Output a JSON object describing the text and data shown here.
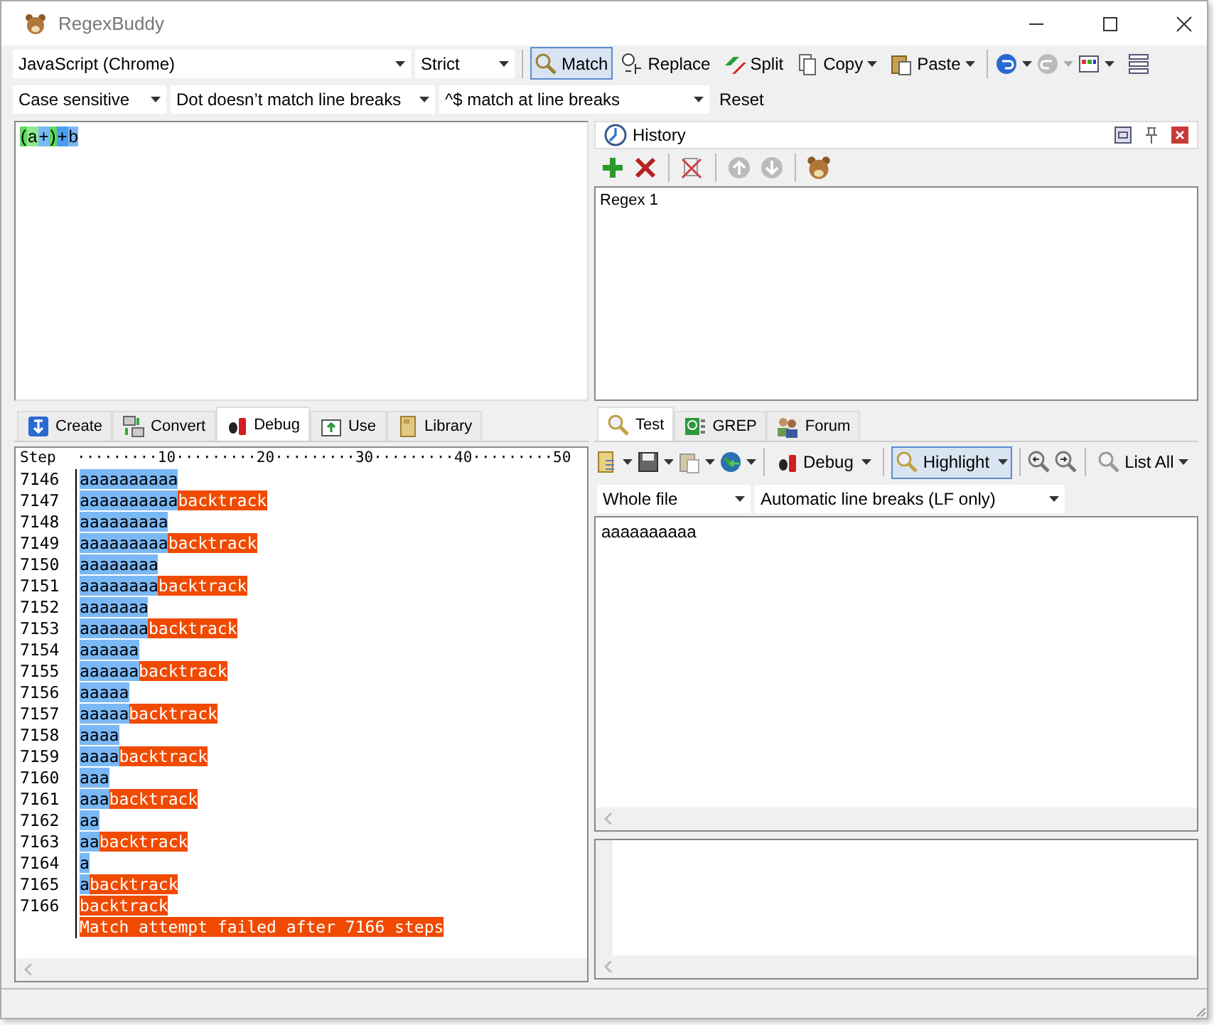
{
  "window": {
    "title": "RegexBuddy"
  },
  "toolbar": {
    "flavor": "JavaScript (Chrome)",
    "mode": "Strict",
    "buttons": [
      {
        "label": "Match",
        "selected": true,
        "menu": false,
        "kind": "match"
      },
      {
        "label": "Replace",
        "selected": false,
        "menu": false,
        "kind": "replace"
      },
      {
        "label": "Split",
        "selected": false,
        "menu": false,
        "kind": "split"
      },
      {
        "label": "Copy",
        "selected": false,
        "menu": true,
        "kind": "copy"
      },
      {
        "label": "Paste",
        "selected": false,
        "menu": true,
        "kind": "paste"
      }
    ]
  },
  "options": {
    "case": "Case sensitive",
    "dot": "Dot doesn’t match line breaks",
    "anchors": "^$ match at line breaks",
    "reset": "Reset"
  },
  "regex": [
    {
      "text": "(",
      "color": "#5ed85e"
    },
    {
      "text": "a",
      "color": "#8ee88e"
    },
    {
      "text": "+",
      "color": "#7ab8f5"
    },
    {
      "text": ")",
      "color": "#5ed85e"
    },
    {
      "text": "+",
      "color": "#4a9cf0"
    },
    {
      "text": "b",
      "color": "#7ab8f5"
    }
  ],
  "history": {
    "title": "History",
    "items": [
      {
        "label": "Regex 1",
        "selected": false
      }
    ]
  },
  "left_tabs": [
    {
      "label": "Create",
      "selected": false,
      "kind": "create"
    },
    {
      "label": "Convert",
      "selected": false,
      "kind": "convert"
    },
    {
      "label": "Debug",
      "selected": true,
      "kind": "debug"
    },
    {
      "label": "Use",
      "selected": false,
      "kind": "use"
    },
    {
      "label": "Library",
      "selected": false,
      "kind": "library"
    }
  ],
  "debug": {
    "header": "Step",
    "ruler": "·········10·········20·········30·········40·········50",
    "rows": [
      {
        "step": "7146",
        "text": "aaaaaaaaaa"
      },
      {
        "step": "7147",
        "text": "aaaaaaaaaa",
        "note": "backtrack"
      },
      {
        "step": "7148",
        "text": "aaaaaaaaa"
      },
      {
        "step": "7149",
        "text": "aaaaaaaaa",
        "note": "backtrack"
      },
      {
        "step": "7150",
        "text": "aaaaaaaa"
      },
      {
        "step": "7151",
        "text": "aaaaaaaa",
        "note": "backtrack"
      },
      {
        "step": "7152",
        "text": "aaaaaaa"
      },
      {
        "step": "7153",
        "text": "aaaaaaa",
        "note": "backtrack"
      },
      {
        "step": "7154",
        "text": "aaaaaa"
      },
      {
        "step": "7155",
        "text": "aaaaaa",
        "note": "backtrack"
      },
      {
        "step": "7156",
        "text": "aaaaa"
      },
      {
        "step": "7157",
        "text": "aaaaa",
        "note": "backtrack"
      },
      {
        "step": "7158",
        "text": "aaaa"
      },
      {
        "step": "7159",
        "text": "aaaa",
        "note": "backtrack"
      },
      {
        "step": "7160",
        "text": "aaa"
      },
      {
        "step": "7161",
        "text": "aaa",
        "note": "backtrack"
      },
      {
        "step": "7162",
        "text": "aa"
      },
      {
        "step": "7163",
        "text": "aa",
        "note": "backtrack"
      },
      {
        "step": "7164",
        "text": "a"
      },
      {
        "step": "7165",
        "text": "a",
        "note": "backtrack"
      },
      {
        "step": "7166",
        "note": "backtrack"
      }
    ],
    "failure": "Match attempt failed after 7166 steps"
  },
  "right_tabs": [
    {
      "label": "Test",
      "selected": true,
      "kind": "test"
    },
    {
      "label": "GREP",
      "selected": false,
      "kind": "grep"
    },
    {
      "label": "Forum",
      "selected": false,
      "kind": "forum"
    }
  ],
  "test_toolbar": {
    "debug": {
      "label": "Debug",
      "selected": false
    },
    "highlight": {
      "label": "Highlight",
      "selected": true
    },
    "list": {
      "label": "List All",
      "selected": false
    }
  },
  "test_options": {
    "scope": "Whole file",
    "line_breaks": "Automatic line breaks (LF only)"
  },
  "test_text": "aaaaaaaaaa"
}
